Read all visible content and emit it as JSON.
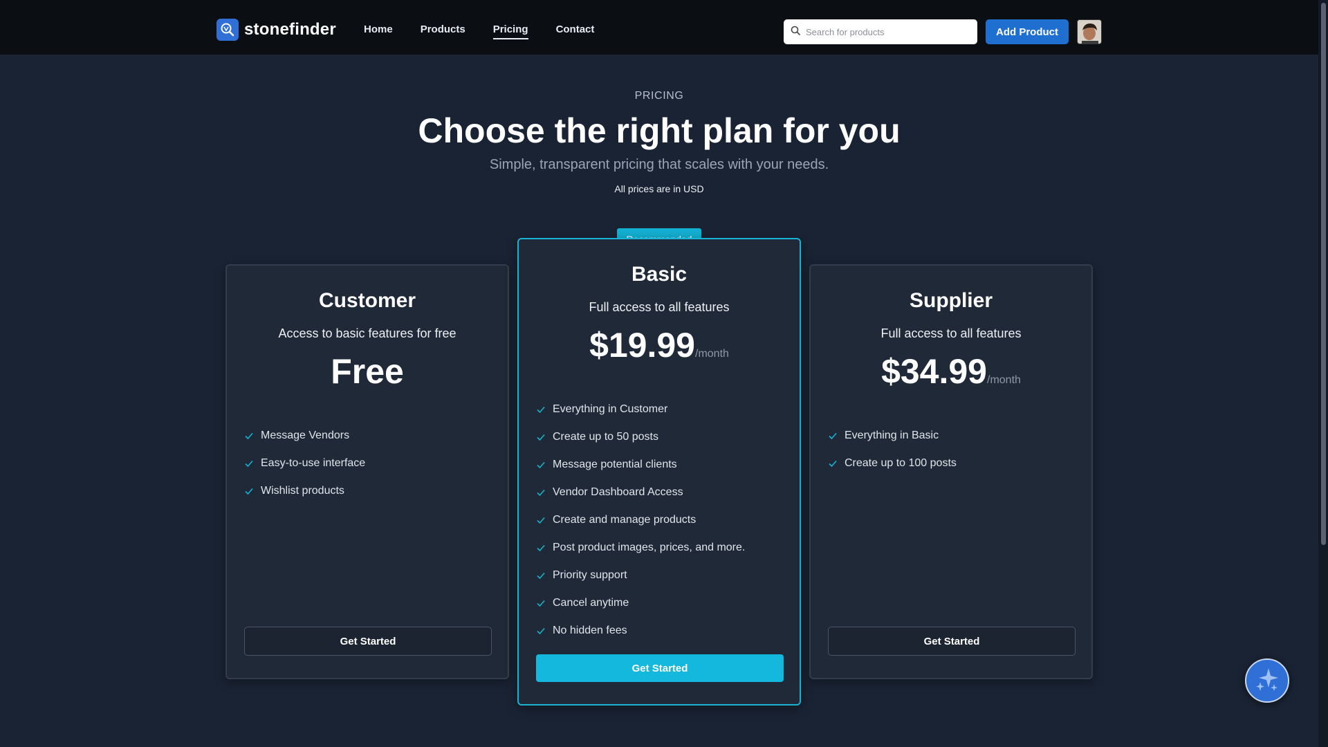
{
  "brand": {
    "name": "stonefinder",
    "logo_icon": "magnifier-logo-icon"
  },
  "nav": {
    "items": [
      "Home",
      "Products",
      "Pricing",
      "Contact"
    ],
    "active": "Pricing"
  },
  "search": {
    "placeholder": "Search for products"
  },
  "header_actions": {
    "add_product_label": "Add Product"
  },
  "hero": {
    "eyebrow": "PRICING",
    "title": "Choose the right plan for you",
    "subtitle": "Simple, transparent pricing that scales with your needs.",
    "note": "All prices are in USD"
  },
  "plans": [
    {
      "title": "Customer",
      "description": "Access to basic features for free",
      "price": "Free",
      "period": "",
      "features": [
        "Message Vendors",
        "Easy-to-use interface",
        "Wishlist products"
      ],
      "cta": "Get Started"
    },
    {
      "badge": "Recommended",
      "title": "Basic",
      "description": "Full access to all features",
      "price": "$19.99",
      "period": "/month",
      "features": [
        "Everything in Customer",
        "Create up to 50 posts",
        "Message potential clients",
        "Vendor Dashboard Access",
        "Create and manage products",
        "Post product images, prices, and more.",
        "Priority support",
        "Cancel anytime",
        "No hidden fees"
      ],
      "cta": "Get Started"
    },
    {
      "title": "Supplier",
      "description": "Full access to all features",
      "price": "$34.99",
      "period": "/month",
      "features": [
        "Everything in Basic",
        "Create up to 100 posts"
      ],
      "cta": "Get Started"
    }
  ],
  "colors": {
    "background": "#1a2333",
    "topbar": "#0b0e13",
    "accent": "#14b8dc",
    "primary_button": "#1f6fd1",
    "check": "#19b3d3"
  },
  "fab": {
    "icon": "sparkles-icon"
  }
}
